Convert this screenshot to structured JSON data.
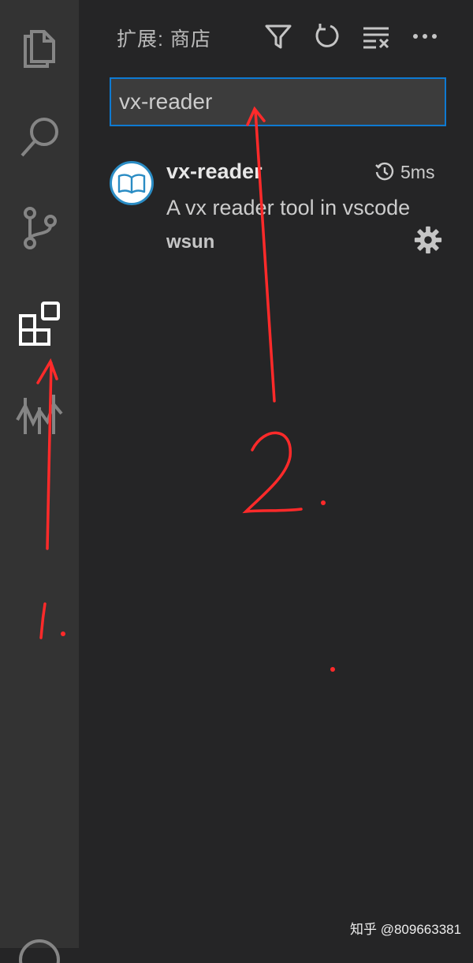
{
  "header": {
    "title": "扩展: 商店"
  },
  "search": {
    "value": "vx-reader"
  },
  "extension": {
    "name": "vx-reader",
    "install_time": "5ms",
    "description": "A vx reader tool in vscode",
    "publisher": "wsun"
  },
  "annotations": {
    "step1": "1.",
    "step2": "2."
  },
  "watermark": "知乎 @809663381",
  "colors": {
    "activity_bar_bg": "#333333",
    "sidebar_bg": "#252526",
    "focus_border": "#0e7ad2",
    "annotation_red": "#ff2a2a"
  },
  "icons": {
    "activity_bar": [
      "files-icon",
      "search-icon",
      "source-control-icon",
      "extensions-icon",
      "remote-explorer-icon"
    ],
    "toolbar": [
      "filter-icon",
      "refresh-icon",
      "clear-results-icon",
      "more-actions-icon"
    ]
  }
}
